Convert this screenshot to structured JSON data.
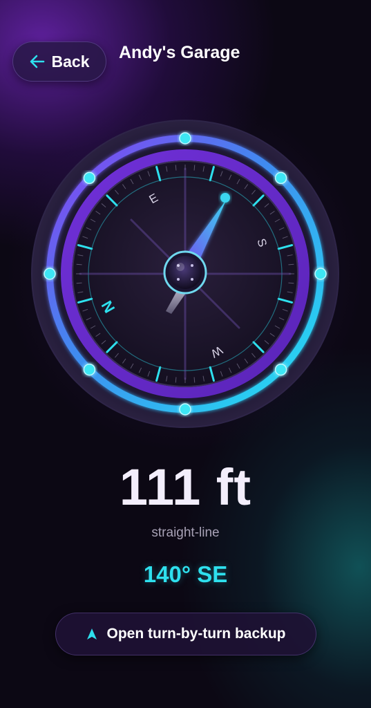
{
  "header": {
    "back_label": "Back",
    "back_icon": "arrow-left-icon",
    "title": "Andy's Garage"
  },
  "compass": {
    "labels": {
      "n": "N",
      "e": "E",
      "s": "S",
      "w": "W"
    },
    "needle_bearing_deg": 140
  },
  "readout": {
    "distance": "111 ft",
    "distance_caption": "straight-line",
    "heading": "140° SE"
  },
  "actions": {
    "turn_by_turn_label": "Open turn-by-turn backup",
    "turn_by_turn_icon": "navigation-arrow-icon"
  },
  "colors": {
    "accent_cyan": "#2ee0ee",
    "accent_purple": "#7a3cf0",
    "background": "#0c0814"
  }
}
